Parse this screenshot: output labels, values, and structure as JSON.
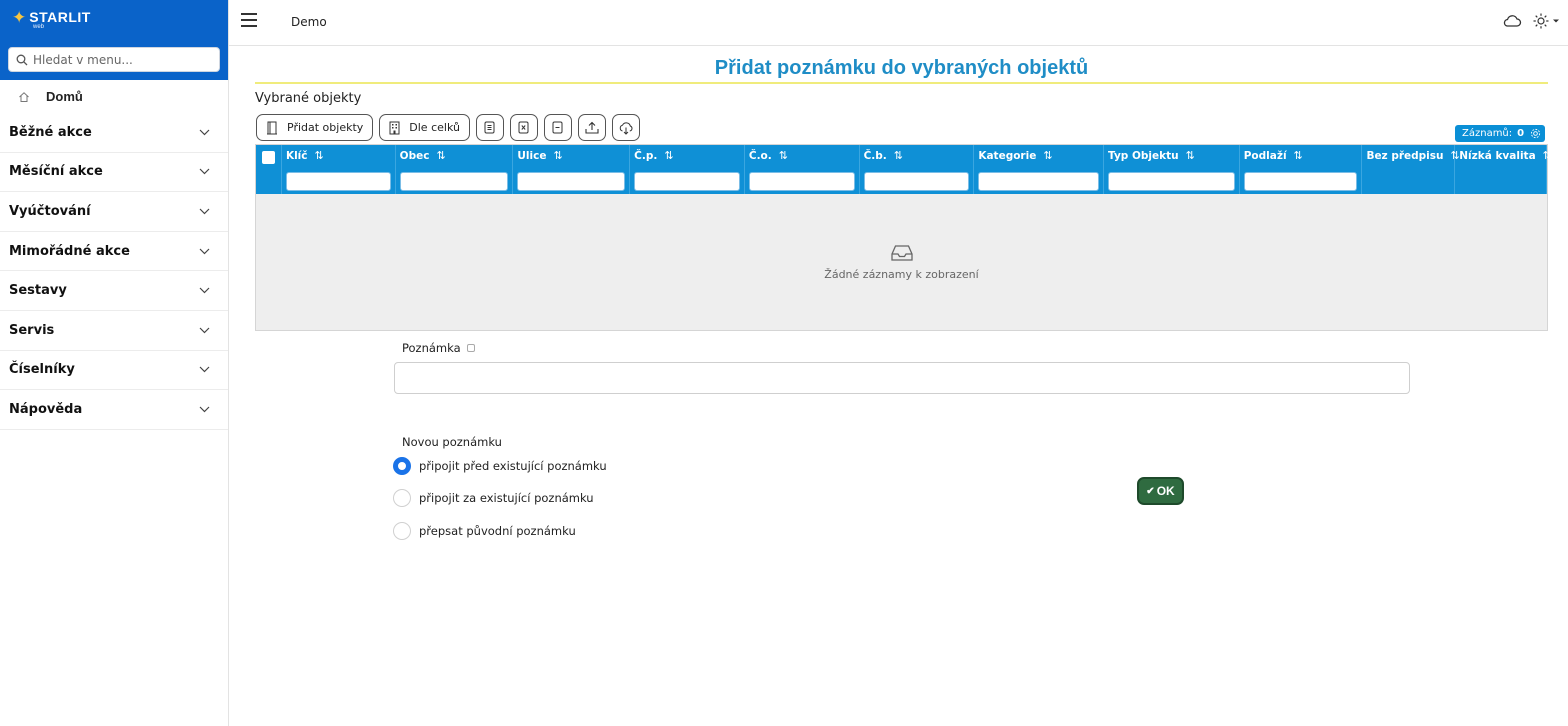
{
  "app": {
    "logo_text": "STARLIT",
    "logo_sub": "web",
    "brand": "Demo"
  },
  "sidebar": {
    "search_placeholder": "Hledat v menu...",
    "home_label": "Domů",
    "items": [
      {
        "label": "Běžné akce"
      },
      {
        "label": "Měsíční akce"
      },
      {
        "label": "Vyúčtování"
      },
      {
        "label": "Mimořádné akce"
      },
      {
        "label": "Sestavy"
      },
      {
        "label": "Servis"
      },
      {
        "label": "Číselníky"
      },
      {
        "label": "Nápověda"
      }
    ]
  },
  "main": {
    "title": "Přidat poznámku do vybraných objektů",
    "section_label": "Vybrané objekty",
    "toolbar": {
      "add_objects": "Přidat objekty",
      "by_units": "Dle celků"
    },
    "records": {
      "label": "Záznamů:",
      "count": "0"
    },
    "columns": [
      {
        "label": "Klíč",
        "sort": "⇅",
        "filter": true
      },
      {
        "label": "Obec",
        "sort": "⇅",
        "filter": true
      },
      {
        "label": "Ulice",
        "sort": "⇅",
        "filter": true
      },
      {
        "label": "Č.p.",
        "sort": "⇅",
        "filter": true
      },
      {
        "label": "Č.o.",
        "sort": "⇅",
        "filter": true
      },
      {
        "label": "Č.b.",
        "sort": "⇅",
        "filter": true
      },
      {
        "label": "Kategorie",
        "sort": "⇅",
        "filter": true
      },
      {
        "label": "Typ Objektu",
        "sort": "⇅",
        "filter": true
      },
      {
        "label": "Podlaží",
        "sort": "⇅",
        "filter": true
      },
      {
        "label": "Bez předpisu",
        "sort": "⇅",
        "filter": false
      },
      {
        "label": "Nízká kvalita",
        "sort": "⇅",
        "filter": false
      }
    ],
    "empty_text": "Žádné záznamy k zobrazení",
    "note_label": "Poznámka",
    "note_value": "",
    "new_note_label": "Novou poznámku",
    "options": [
      {
        "label": "připojit před existující poznámku",
        "selected": true
      },
      {
        "label": "připojit za existující poznámku",
        "selected": false
      },
      {
        "label": "přepsat původní poznámku",
        "selected": false
      }
    ],
    "ok_label": "OK"
  },
  "colors": {
    "sidebar_header": "#0a63c9",
    "grid_header": "#0f90d6",
    "title": "#1f8dc6",
    "ok_button": "#2f6b40",
    "radio_selected": "#1a73e8"
  }
}
